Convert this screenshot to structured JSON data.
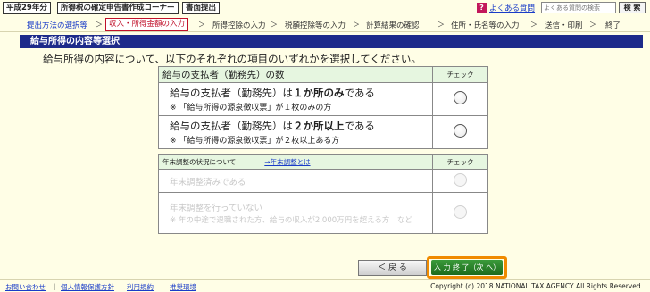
{
  "header": {
    "year_tag": "平成29年分",
    "corner_tag": "所得税の確定申告書作成コーナー",
    "print_tag": "書面提出",
    "help_icon": "?",
    "help_link": "よくある質問",
    "search_placeholder": "よくある質問の検索",
    "search_button": "検 索"
  },
  "progress": {
    "steps": [
      {
        "label": "提出方法の選択等",
        "state": "link"
      },
      {
        "label": "収入・所得金額の入力",
        "state": "current"
      },
      {
        "label": "所得控除の入力",
        "state": "pending"
      },
      {
        "label": "税額控除等の入力",
        "state": "pending"
      },
      {
        "label": "計算結果の確認",
        "state": "pending"
      },
      {
        "label": "住所・氏名等の入力",
        "state": "pending"
      },
      {
        "label": "送信・印刷",
        "state": "pending"
      },
      {
        "label": "終了",
        "state": "pending"
      }
    ],
    "separator": "＞"
  },
  "page": {
    "title": "給与所得の内容等選択",
    "instruction": "給与所得の内容について、以下のそれぞれの項目のいずれかを選択してください。"
  },
  "question1": {
    "header": "給与の支払者（勤務先）の数",
    "check_header": "チェック",
    "options": [
      {
        "line1_a": "給与の支払者（勤務先）は",
        "line1_b": "１か所のみ",
        "line1_c": "である",
        "note": "※ 「給与所得の源泉徴収票」が１枚のみの方"
      },
      {
        "line1_a": "給与の支払者（勤務先）は",
        "line1_b": "２か所以上",
        "line1_c": "である",
        "note": "※ 「給与所得の源泉徴収票」が２枚以上ある方"
      }
    ]
  },
  "question2": {
    "header": "年末調整の状況について",
    "header_link": "→年末調整とは",
    "check_header": "チェック",
    "options": [
      {
        "label": "年末調整済みである",
        "note": ""
      },
      {
        "label": "年末調整を行っていない",
        "note": "※ 年の中途で退職された方、給与の収入が2,000万円を超える方　など"
      }
    ]
  },
  "buttons": {
    "back": "＜ 戻 る",
    "next": "入 力 終 了（次 へ）＞"
  },
  "footer": {
    "links": [
      "お問い合わせ",
      "個人情報保護方針",
      "利用規約",
      "推奨環境"
    ],
    "separator": "｜",
    "copyright": "Copyright (c) 2018 NATIONAL TAX AGENCY All Rights Reserved."
  },
  "colors": {
    "title_bar": "#1d2a8a",
    "current_step": "#c0102a",
    "next_button": "#1d6b1d",
    "highlight": "#f08a00"
  }
}
